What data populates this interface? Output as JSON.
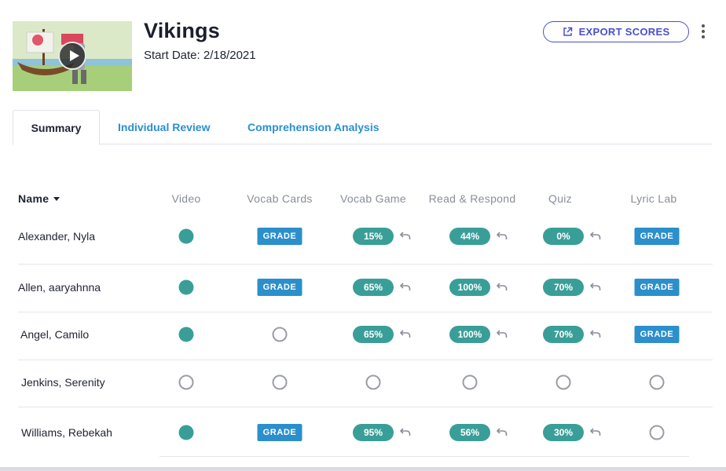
{
  "header": {
    "title": "Vikings",
    "start_date": "Start Date: 2/18/2021",
    "export_label": "EXPORT SCORES"
  },
  "tabs": [
    {
      "label": "Summary",
      "active": true
    },
    {
      "label": "Individual Review",
      "active": false
    },
    {
      "label": "Comprehension Analysis",
      "active": false
    }
  ],
  "columns": [
    "Name",
    "Video",
    "Vocab Cards",
    "Vocab Game",
    "Read & Respond",
    "Quiz",
    "Lyric Lab"
  ],
  "students": [
    {
      "name": "Alexander, Nyla",
      "cells": [
        {
          "type": "done"
        },
        {
          "type": "grade",
          "label": "GRADE"
        },
        {
          "type": "score",
          "value": "15%"
        },
        {
          "type": "score",
          "value": "44%"
        },
        {
          "type": "score",
          "value": "0%"
        },
        {
          "type": "grade",
          "label": "GRADE"
        }
      ]
    },
    {
      "name": "Allen, aaryahnna",
      "cells": [
        {
          "type": "done"
        },
        {
          "type": "grade",
          "label": "GRADE"
        },
        {
          "type": "score",
          "value": "65%"
        },
        {
          "type": "score",
          "value": "100%"
        },
        {
          "type": "score",
          "value": "70%"
        },
        {
          "type": "grade",
          "label": "GRADE"
        }
      ]
    },
    {
      "name": "Angel, Camilo",
      "cells": [
        {
          "type": "done"
        },
        {
          "type": "empty"
        },
        {
          "type": "score",
          "value": "65%"
        },
        {
          "type": "score",
          "value": "100%"
        },
        {
          "type": "score",
          "value": "70%"
        },
        {
          "type": "grade",
          "label": "GRADE"
        }
      ]
    },
    {
      "name": "Jenkins, Serenity",
      "cells": [
        {
          "type": "empty"
        },
        {
          "type": "empty"
        },
        {
          "type": "empty"
        },
        {
          "type": "empty"
        },
        {
          "type": "empty"
        },
        {
          "type": "empty"
        }
      ]
    },
    {
      "name": "Williams, Rebekah",
      "cells": [
        {
          "type": "done"
        },
        {
          "type": "grade",
          "label": "GRADE"
        },
        {
          "type": "score",
          "value": "95%"
        },
        {
          "type": "score",
          "value": "56%"
        },
        {
          "type": "score",
          "value": "30%"
        },
        {
          "type": "empty"
        }
      ]
    }
  ],
  "colors": {
    "accent": "#4b4fc9",
    "grade_blue": "#2b8fcb",
    "teal": "#3a9e98",
    "tab_link": "#2a8fd0"
  },
  "icons": [
    "play-icon",
    "external-link-icon",
    "more-vertical-icon",
    "caret-down-icon",
    "undo-icon"
  ]
}
